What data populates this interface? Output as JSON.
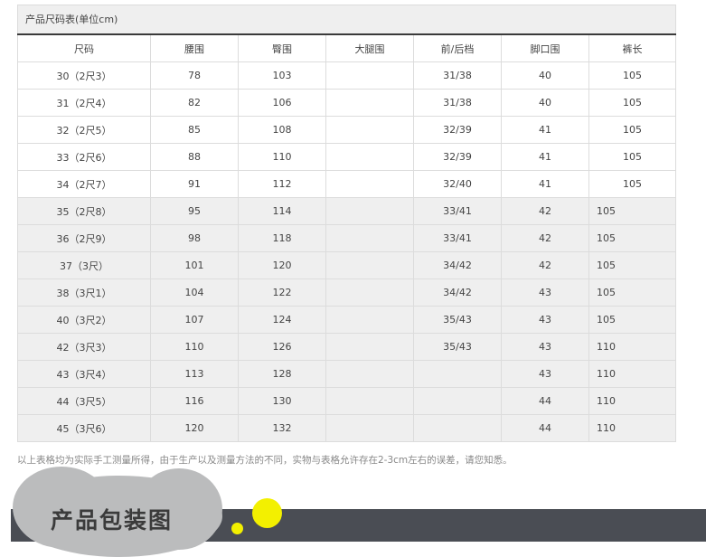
{
  "table": {
    "caption": "产品尺码表(单位cm)",
    "headers": [
      "尺码",
      "腰围",
      "臀围",
      "大腿围",
      "前/后档",
      "脚口围",
      "裤长"
    ],
    "rows": [
      [
        "30（2尺3）",
        "78",
        "103",
        "",
        "31/38",
        "40",
        "105"
      ],
      [
        "31（2尺4）",
        "82",
        "106",
        "",
        "31/38",
        "40",
        "105"
      ],
      [
        "32（2尺5）",
        "85",
        "108",
        "",
        "32/39",
        "41",
        "105"
      ],
      [
        "33（2尺6）",
        "88",
        "110",
        "",
        "32/39",
        "41",
        "105"
      ],
      [
        "34（2尺7）",
        "91",
        "112",
        "",
        "32/40",
        "41",
        "105"
      ],
      [
        "35（2尺8）",
        "95",
        "114",
        "",
        "33/41",
        "42",
        "105"
      ],
      [
        "36（2尺9）",
        "98",
        "118",
        "",
        "33/41",
        "42",
        "105"
      ],
      [
        "37（3尺）",
        "101",
        "120",
        "",
        "34/42",
        "42",
        "105"
      ],
      [
        "38（3尺1）",
        "104",
        "122",
        "",
        "34/42",
        "43",
        "105"
      ],
      [
        "40（3尺2）",
        "107",
        "124",
        "",
        "35/43",
        "43",
        "105"
      ],
      [
        "42（3尺3）",
        "110",
        "126",
        "",
        "35/43",
        "43",
        "110"
      ],
      [
        "43（3尺4）",
        "113",
        "128",
        "",
        "",
        "43",
        "110"
      ],
      [
        "44（3尺5）",
        "116",
        "130",
        "",
        "",
        "44",
        "110"
      ],
      [
        "45（3尺6）",
        "120",
        "132",
        "",
        "",
        "44",
        "110"
      ]
    ]
  },
  "note": "以上表格均为实际手工测量所得，由于生产以及测量方法的不同，实物与表格允许存在2-3cm左右的误差，请您知悉。",
  "banner": {
    "title": "产品包装图"
  },
  "colors": {
    "banner_dark": "#4a4d54",
    "bubble_gray": "#bbbcbd",
    "accent_yellow": "#f3f000",
    "row_gray": "#efefef"
  }
}
